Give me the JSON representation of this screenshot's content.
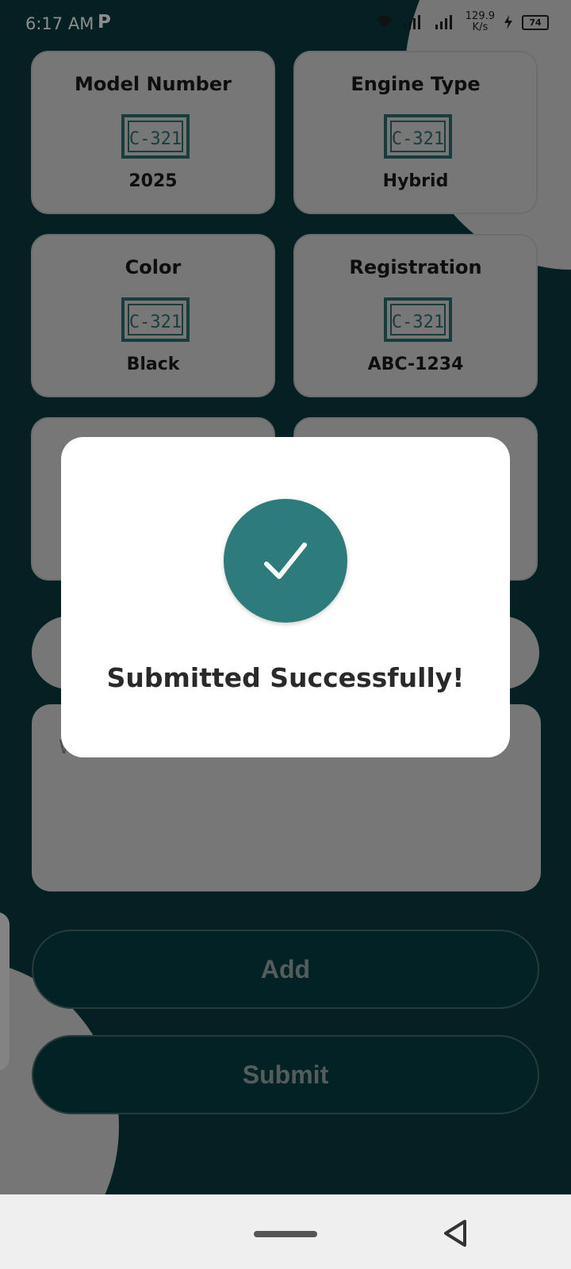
{
  "status_bar": {
    "time": "6:17 AM",
    "app_indicator": "P",
    "speed_value": "129.9",
    "speed_unit": "K/s",
    "battery": "74"
  },
  "cards": [
    {
      "title": "Model Number",
      "icon": "license-plate-icon",
      "plate_text": "C-321",
      "value": "2025"
    },
    {
      "title": "Engine Type",
      "icon": "license-plate-icon",
      "plate_text": "C-321",
      "value": "Hybrid"
    },
    {
      "title": "Color",
      "icon": "license-plate-icon",
      "plate_text": "C-321",
      "value": "Black"
    },
    {
      "title": "Registration",
      "icon": "license-plate-icon",
      "plate_text": "C-321",
      "value": "ABC-1234"
    }
  ],
  "textarea": {
    "placeholder_partial": "W"
  },
  "buttons": {
    "add": "Add",
    "submit": "Submit"
  },
  "dialog": {
    "message": "Submitted Successfully!",
    "icon": "checkmark-icon"
  },
  "colors": {
    "background": "#0a3b40",
    "card": "#d9d9d9",
    "accent": "#2e7b7b",
    "button": "#063f44"
  }
}
